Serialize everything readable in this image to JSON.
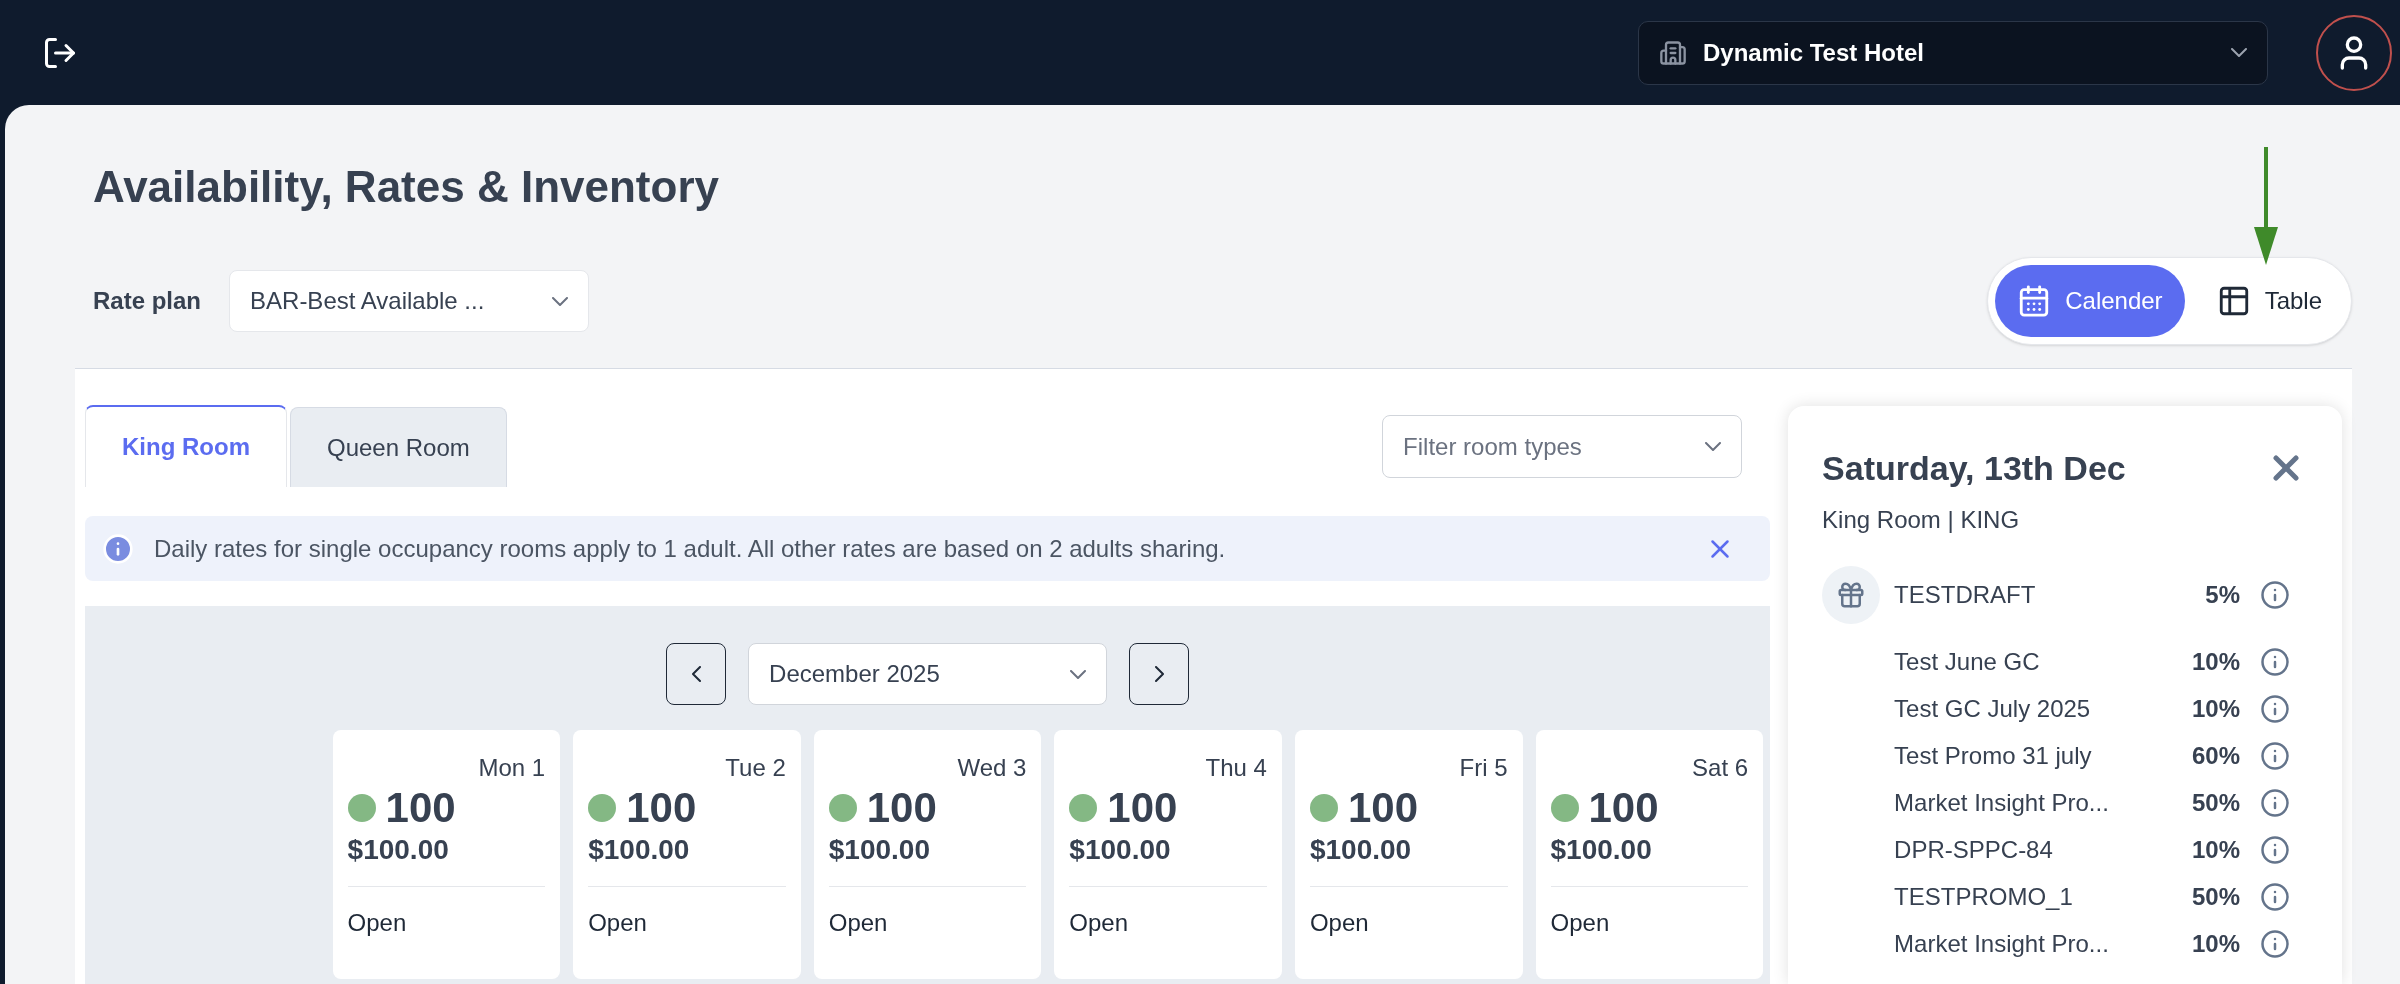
{
  "header": {
    "hotel_select": {
      "value": "Dynamic Test Hotel"
    }
  },
  "page": {
    "title": "Availability, Rates & Inventory",
    "rate_plan": {
      "label": "Rate plan",
      "value": "BAR-Best Available ..."
    },
    "view_toggle": [
      {
        "label": "Calender",
        "selected": true
      },
      {
        "label": "Table",
        "selected": false
      }
    ],
    "room_tabs": [
      {
        "label": "King Room",
        "selected": true
      },
      {
        "label": "Queen Room",
        "selected": false
      }
    ],
    "filter": {
      "placeholder": "Filter room types"
    },
    "notice": "Daily rates for single occupancy rooms apply to 1 adult. All other rates are based on 2 adults sharing.",
    "month_select": {
      "value": "December 2025"
    },
    "days": [
      {
        "label": "Mon 1",
        "available": "100",
        "rate": "$100.00",
        "status": "Open",
        "color": "#84b884"
      },
      {
        "label": "Tue 2",
        "available": "100",
        "rate": "$100.00",
        "status": "Open",
        "color": "#84b884"
      },
      {
        "label": "Wed 3",
        "available": "100",
        "rate": "$100.00",
        "status": "Open",
        "color": "#84b884"
      },
      {
        "label": "Thu 4",
        "available": "100",
        "rate": "$100.00",
        "status": "Open",
        "color": "#84b884"
      },
      {
        "label": "Fri 5",
        "available": "100",
        "rate": "$100.00",
        "status": "Open",
        "color": "#84b884"
      },
      {
        "label": "Sat 6",
        "available": "100",
        "rate": "$100.00",
        "status": "Open",
        "color": "#84b884"
      }
    ],
    "day_panel": {
      "title": "Saturday, 13th Dec",
      "subtitle": "King Room | KING",
      "promotions": [
        {
          "kind": "gift",
          "name": "TESTDRAFT",
          "discount": "5%"
        },
        {
          "kind": "plain",
          "name": "Test June GC",
          "discount": "10%"
        },
        {
          "kind": "plain",
          "name": "Test GC July 2025",
          "discount": "10%"
        },
        {
          "kind": "plain",
          "name": "Test Promo 31 july",
          "discount": "60%"
        },
        {
          "kind": "plain",
          "name": "Market Insight Pro...",
          "discount": "50%"
        },
        {
          "kind": "plain",
          "name": "DPR-SPPC-84",
          "discount": "10%"
        },
        {
          "kind": "plain",
          "name": "TESTPROMO_1",
          "discount": "50%"
        },
        {
          "kind": "plain",
          "name": "Market Insight Pro...",
          "discount": "10%"
        }
      ]
    }
  }
}
